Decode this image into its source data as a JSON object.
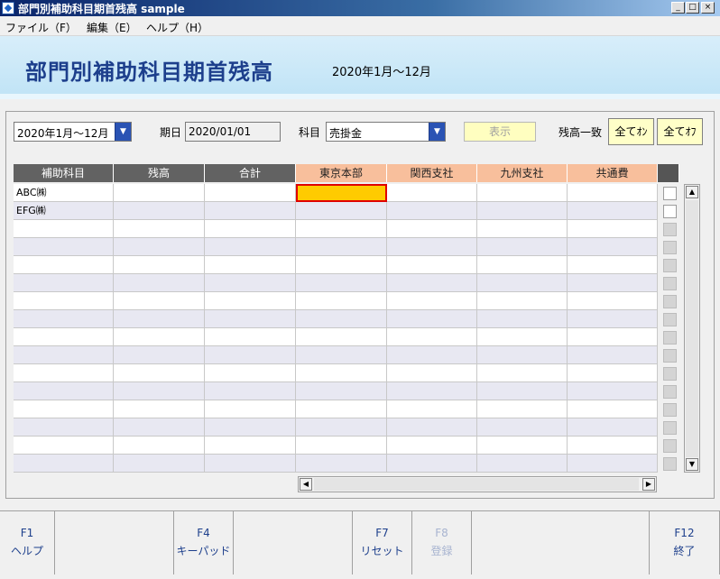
{
  "window": {
    "title": "部門別補助科目期首残高 sample",
    "min": "_",
    "max": "□",
    "close": "×"
  },
  "menu": [
    {
      "label": "ファイル（F）"
    },
    {
      "label": "編集（E）"
    },
    {
      "label": "ヘルプ（H）"
    }
  ],
  "header": {
    "title": "部門別補助科目期首残高",
    "period": "2020年1月～12月"
  },
  "toolbar": {
    "period_value": "2020年1月～12月",
    "date_label": "期日",
    "date_value": "2020/01/01",
    "account_label": "科目",
    "account_value": "売掛金",
    "show_label": "表示",
    "balance_label": "残高一致",
    "all_on_label": "全てｵﾝ",
    "all_off_label": "全てｵﾌ"
  },
  "grid": {
    "columns": [
      "補助科目",
      "残高",
      "合計",
      "東京本部",
      "関西支社",
      "九州支社",
      "共通費"
    ],
    "rows": [
      [
        "ABC㈱",
        "",
        "",
        "",
        "",
        "",
        ""
      ],
      [
        "EFG㈱",
        "",
        "",
        "",
        "",
        "",
        ""
      ],
      [
        "",
        "",
        "",
        "",
        "",
        "",
        ""
      ],
      [
        "",
        "",
        "",
        "",
        "",
        "",
        ""
      ],
      [
        "",
        "",
        "",
        "",
        "",
        "",
        ""
      ],
      [
        "",
        "",
        "",
        "",
        "",
        "",
        ""
      ],
      [
        "",
        "",
        "",
        "",
        "",
        "",
        ""
      ],
      [
        "",
        "",
        "",
        "",
        "",
        "",
        ""
      ],
      [
        "",
        "",
        "",
        "",
        "",
        "",
        ""
      ],
      [
        "",
        "",
        "",
        "",
        "",
        "",
        ""
      ],
      [
        "",
        "",
        "",
        "",
        "",
        "",
        ""
      ],
      [
        "",
        "",
        "",
        "",
        "",
        "",
        ""
      ],
      [
        "",
        "",
        "",
        "",
        "",
        "",
        ""
      ],
      [
        "",
        "",
        "",
        "",
        "",
        "",
        ""
      ],
      [
        "",
        "",
        "",
        "",
        "",
        "",
        ""
      ],
      [
        "",
        "",
        "",
        "",
        "",
        "",
        ""
      ]
    ],
    "active_cell": {
      "row": 0,
      "column": "東京本部"
    }
  },
  "fkeys": [
    {
      "key": "F1",
      "label": "ヘルプ",
      "enabled": true
    },
    {
      "key": "",
      "label": "",
      "enabled": true
    },
    {
      "key": "F4",
      "label": "キーパッド",
      "enabled": true
    },
    {
      "key": "",
      "label": "",
      "enabled": true
    },
    {
      "key": "F7",
      "label": "リセット",
      "enabled": true
    },
    {
      "key": "F8",
      "label": "登録",
      "enabled": false
    },
    {
      "key": "",
      "label": "",
      "enabled": true
    },
    {
      "key": "F12",
      "label": "終了",
      "enabled": true
    }
  ],
  "colors": {
    "title_blue": "#1d3f8c",
    "header_orange": "#f8bf9c",
    "active_cell": "#ffcb00",
    "active_border": "#e00000"
  }
}
